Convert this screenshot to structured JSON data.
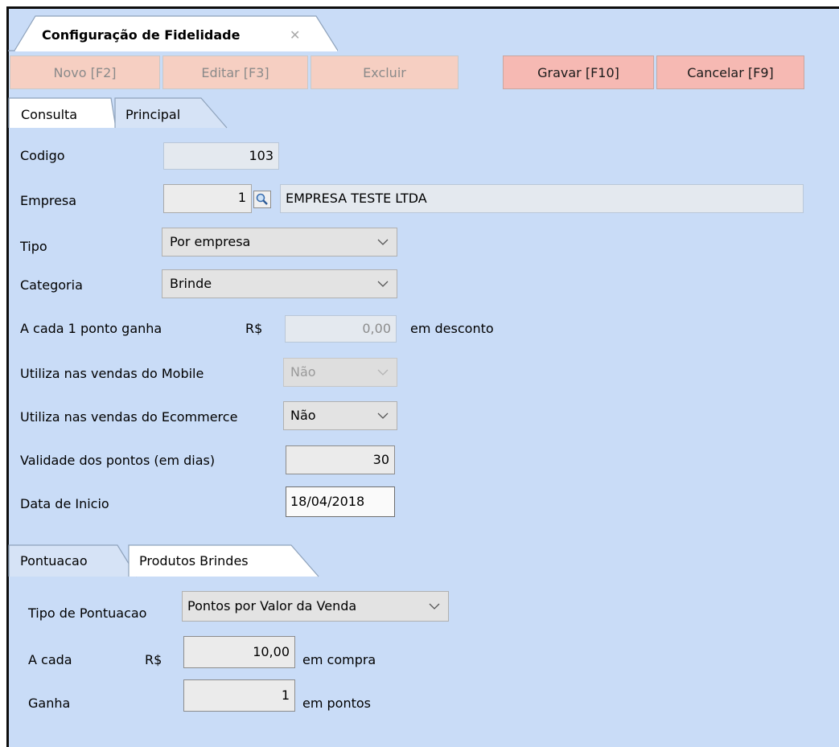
{
  "window_tab": {
    "title": "Configuração de Fidelidade",
    "close_glyph": "✕"
  },
  "toolbar": {
    "novo": "Novo [F2]",
    "editar": "Editar [F3]",
    "excluir": "Excluir",
    "gravar": "Gravar [F10]",
    "cancelar": "Cancelar [F9]"
  },
  "main_tabs": [
    {
      "label": "Consulta"
    },
    {
      "label": "Principal"
    }
  ],
  "form": {
    "codigo": {
      "label": "Codigo",
      "value": "103"
    },
    "empresa": {
      "label": "Empresa",
      "id": "1",
      "name": "EMPRESA TESTE LTDA"
    },
    "tipo": {
      "label": "Tipo",
      "value": "Por empresa"
    },
    "categoria": {
      "label": "Categoria",
      "value": "Brinde"
    },
    "ponto": {
      "label": "A cada 1 ponto ganha",
      "currency": "R$",
      "value": "0,00",
      "suffix": "em desconto"
    },
    "mobile": {
      "label": "Utiliza nas vendas do Mobile",
      "value": "Não"
    },
    "ecommerce": {
      "label": "Utiliza nas vendas do Ecommerce",
      "value": "Não"
    },
    "validade": {
      "label": "Validade dos pontos (em dias)",
      "value": "30"
    },
    "data_inicio": {
      "label": "Data de Inicio",
      "value": "18/04/2018"
    }
  },
  "sub_tabs": [
    {
      "label": "Pontuacao"
    },
    {
      "label": "Produtos Brindes"
    }
  ],
  "pontuacao": {
    "tipo": {
      "label": "Tipo de Pontuacao",
      "value": "Pontos por Valor da Venda"
    },
    "a_cada": {
      "label": "A cada",
      "currency": "R$",
      "value": "10,00",
      "suffix": "em compra"
    },
    "ganha": {
      "label": "Ganha",
      "value": "1",
      "suffix": "em pontos"
    }
  },
  "icons": {
    "lookup": "magnifier-icon",
    "dropdown": "chevron-down-icon"
  }
}
